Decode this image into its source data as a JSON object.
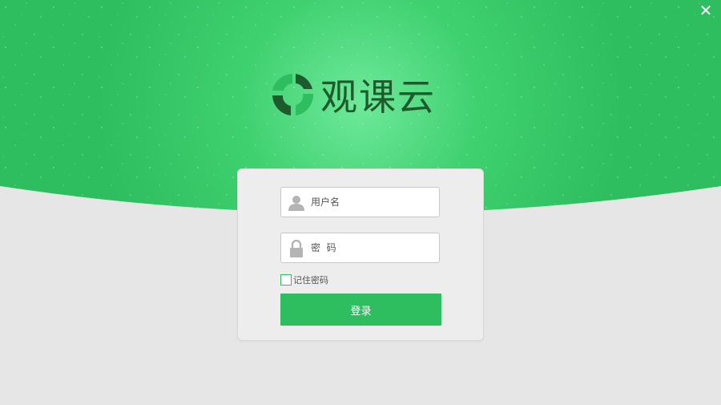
{
  "window": {
    "close_symbol": "✕"
  },
  "logo": {
    "icon": "guanke-logo-icon",
    "text": "观课云"
  },
  "login": {
    "username_placeholder": "用户名",
    "password_placeholder": "密  码",
    "remember_label": "记住密码",
    "remember_checked": false,
    "submit_label": "登录"
  },
  "colors": {
    "brand_green": "#2ebd5f",
    "dark_green": "#1d5a2c",
    "background": "#e6e6e6"
  }
}
